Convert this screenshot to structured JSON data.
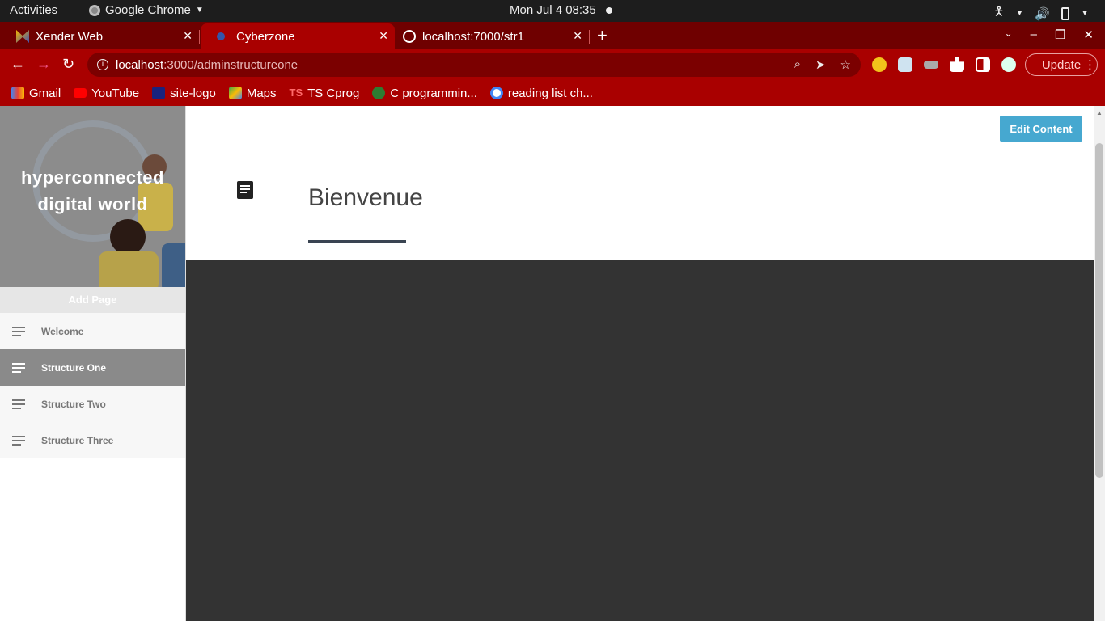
{
  "os": {
    "activities": "Activities",
    "app_name": "Google Chrome",
    "clock": "Mon Jul 4  08:35"
  },
  "tabs": [
    {
      "title": "Xender Web"
    },
    {
      "title": "Cyberzone"
    },
    {
      "title": "localhost:7000/str1"
    }
  ],
  "address": {
    "host": "localhost",
    "path": ":3000/adminstructureone"
  },
  "update_label": "Update",
  "bookmarks": [
    {
      "label": "Gmail"
    },
    {
      "label": "YouTube"
    },
    {
      "label": "site-logo"
    },
    {
      "label": "Maps"
    },
    {
      "label": "TS Cprog"
    },
    {
      "label": "C programmin..."
    },
    {
      "label": "reading list ch..."
    }
  ],
  "sidebar": {
    "hero_title": "hyperconnected digital world",
    "add_page": "Add Page",
    "items": [
      {
        "label": "Welcome"
      },
      {
        "label": "Structure One"
      },
      {
        "label": "Structure Two"
      },
      {
        "label": "Structure Three"
      }
    ]
  },
  "main": {
    "heading": "Bienvenue",
    "edit_button": "Edit Content"
  },
  "colors": {
    "browser_accent": "#a90000",
    "edit_button": "#46a8d0",
    "content_dark": "#333333"
  }
}
